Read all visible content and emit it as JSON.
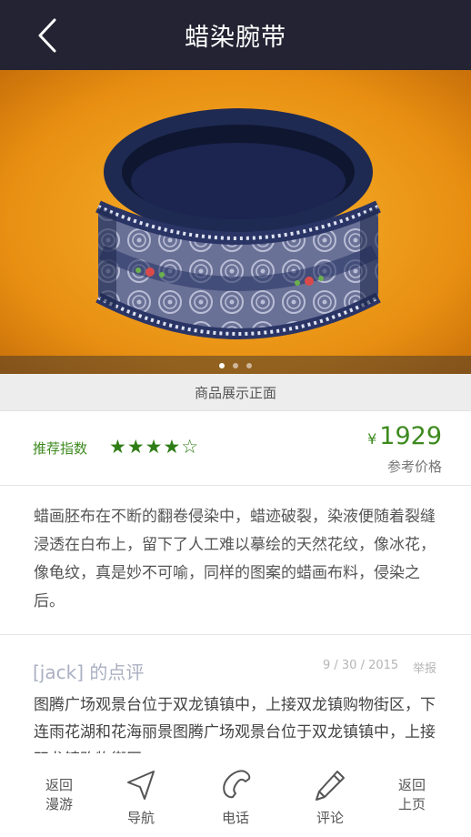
{
  "header": {
    "title": "蜡染腕带",
    "back_icon": "chevron-left-icon"
  },
  "hero": {
    "caption": "商品展示正面",
    "slide_count": 3,
    "active_slide": 1
  },
  "rating": {
    "label": "推荐指数",
    "stars_text": "★★★★☆",
    "stars_value": 4,
    "stars_max": 5,
    "currency": "¥",
    "price": "1929",
    "price_label": "参考价格"
  },
  "description": "蜡画胚布在不断的翻卷侵染中，蜡迹破裂，染液便随着裂缝浸透在白布上，留下了人工难以摹绘的天然花纹，像冰花，像龟纹，真是妙不可喻，同样的图案的蜡画布料，侵染之后。",
  "review": {
    "author": "[jack] 的点评",
    "date": "9 / 30 / 2015",
    "report": "举报",
    "text": "图腾广场观景台位于双龙镇镇中，上接双龙镇购物街区，下连雨花湖和花海丽景图腾广场观景台位于双龙镇镇中，上接双龙镇购物街区"
  },
  "bottom_bar": {
    "back_tour_line1": "返回",
    "back_tour_line2": "漫游",
    "navigate": "导航",
    "phone": "电话",
    "comment": "评论",
    "back_page_line1": "返回",
    "back_page_line2": "上页"
  },
  "colors": {
    "header_bg": "#232333",
    "accent_green": "#3d8a1f",
    "star_green": "#2f7d16"
  }
}
